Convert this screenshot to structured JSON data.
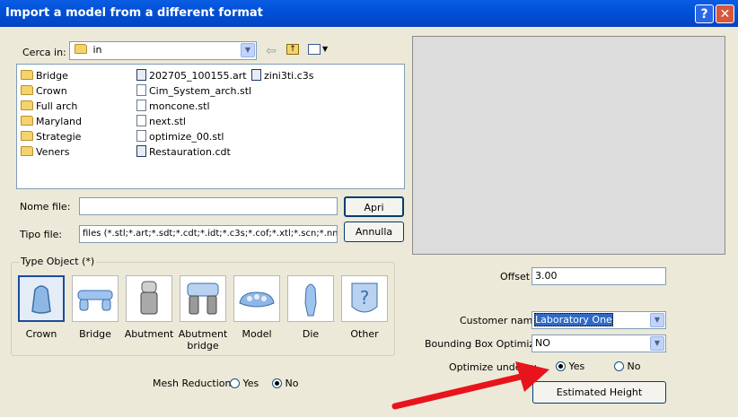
{
  "window": {
    "title": "Import a model from a different format",
    "help_glyph": "?",
    "close_glyph": "✕"
  },
  "look_in": {
    "label": "Cerca in:",
    "value": "in"
  },
  "files": {
    "folders": [
      "Bridge",
      "Crown",
      "Full arch",
      "Maryland",
      "Strategie",
      "Veners"
    ],
    "col2": [
      {
        "name": "202705_100155.art",
        "icon": "art-file-icon"
      },
      {
        "name": "Cim_System_arch.stl",
        "icon": "stl-file-icon"
      },
      {
        "name": "moncone.stl",
        "icon": "stl-file-icon"
      },
      {
        "name": "next.stl",
        "icon": "stl-file-icon"
      },
      {
        "name": "optimize_00.stl",
        "icon": "stl-file-icon"
      },
      {
        "name": "Restauration.cdt",
        "icon": "cdt-file-icon"
      }
    ],
    "col3": [
      {
        "name": "zini3ti.c3s",
        "icon": "c3s-file-icon"
      }
    ]
  },
  "filename": {
    "label": "Nome file:",
    "value": ""
  },
  "filetype": {
    "label": "Tipo file:",
    "value": "files (*.stl;*.art;*.sdt;*.cdt;*.idt;*.c3s;*.cof;*.xtl;*.scn;*.nmdl;*.ft"
  },
  "buttons": {
    "open": "Apri",
    "cancel": "Annulla",
    "estimated_height": "Estimated Height"
  },
  "type_object": {
    "label": "Type Object (*)",
    "selected": "Crown",
    "items": [
      {
        "label": "Crown",
        "icon": "crown-icon"
      },
      {
        "label": "Bridge",
        "icon": "bridge-icon"
      },
      {
        "label": "Abutment",
        "icon": "abutment-icon"
      },
      {
        "label": "Abutment bridge",
        "icon": "abutment-bridge-icon"
      },
      {
        "label": "Model",
        "icon": "model-icon"
      },
      {
        "label": "Die",
        "icon": "die-icon"
      },
      {
        "label": "Other",
        "icon": "other-icon"
      }
    ]
  },
  "mesh_reduction": {
    "label": "Mesh Reduction",
    "yes": "Yes",
    "no": "No",
    "selected": "No"
  },
  "offset": {
    "label": "Offset",
    "value": "3.00"
  },
  "customer": {
    "label": "Customer name",
    "value": "Laboratory One"
  },
  "bbox_optimizer": {
    "label": "Bounding Box Optimizer",
    "value": "NO"
  },
  "optimize_undercut": {
    "label": "Optimize undercu",
    "yes": "Yes",
    "no": "No",
    "selected": "Yes"
  },
  "colors": {
    "titlebar": "#0054e3",
    "dialog_bg": "#ece9d8",
    "arrow": "#e8141b",
    "selection": "#316ac5"
  }
}
